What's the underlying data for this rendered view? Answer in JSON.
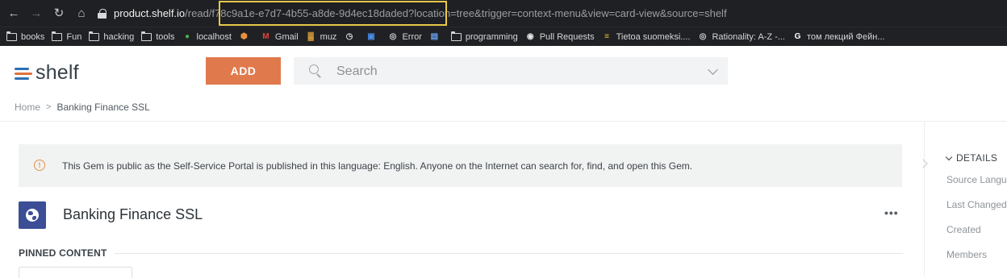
{
  "browser": {
    "url_host": "product.shelf.io",
    "url_path": "/read/f78c9a1e-e7d7-4b55-a8de-9d4ec18daded?location=tree&trigger=context-menu&view=card-view&source=shelf",
    "bookmarks": [
      {
        "label": "books",
        "icon": "folder-icon"
      },
      {
        "label": "Fun",
        "icon": "folder-icon"
      },
      {
        "label": "hacking",
        "icon": "folder-icon"
      },
      {
        "label": "tools",
        "icon": "folder-icon"
      },
      {
        "label": "localhost",
        "icon": "globe-green-icon"
      },
      {
        "label": "",
        "icon": "hexagon-icon"
      },
      {
        "label": "Gmail",
        "icon": "gmail-icon"
      },
      {
        "label": "muz",
        "icon": "music-bars-icon"
      },
      {
        "label": "",
        "icon": "clock-icon"
      },
      {
        "label": "",
        "icon": "app-icon"
      },
      {
        "label": "Error",
        "icon": "globe-icon"
      },
      {
        "label": "",
        "icon": "translate-icon"
      },
      {
        "label": "programming",
        "icon": "folder-icon"
      },
      {
        "label": "Pull Requests",
        "icon": "github-icon"
      },
      {
        "label": "Tietoa suomeksi....",
        "icon": "flag-icon"
      },
      {
        "label": "Rationality: A-Z -...",
        "icon": "globe-icon"
      },
      {
        "label": "том лекций Фейн...",
        "icon": "google-icon"
      }
    ]
  },
  "header": {
    "logo_text": "shelf",
    "add_label": "ADD",
    "search_placeholder": "Search"
  },
  "breadcrumb": {
    "home": "Home",
    "separator": ">",
    "current": "Banking Finance SSL"
  },
  "notice": {
    "icon_glyph": "!",
    "text": "This Gem is public as the Self-Service Portal is published in this language: English. Anyone on the Internet can search for, find, and open this Gem."
  },
  "gem": {
    "title": "Banking Finance SSL",
    "more_label": "•••"
  },
  "pinned": {
    "heading": "PINNED CONTENT"
  },
  "details": {
    "heading": "DETAILS",
    "items": [
      "Source Langu",
      "Last Changed",
      "Created",
      "Members"
    ]
  },
  "colors": {
    "accent": "#e07a4c",
    "brand_blue": "#2e6fb7",
    "gem_icon_bg": "#3b4e96",
    "highlight_box": "#e8c84a"
  }
}
